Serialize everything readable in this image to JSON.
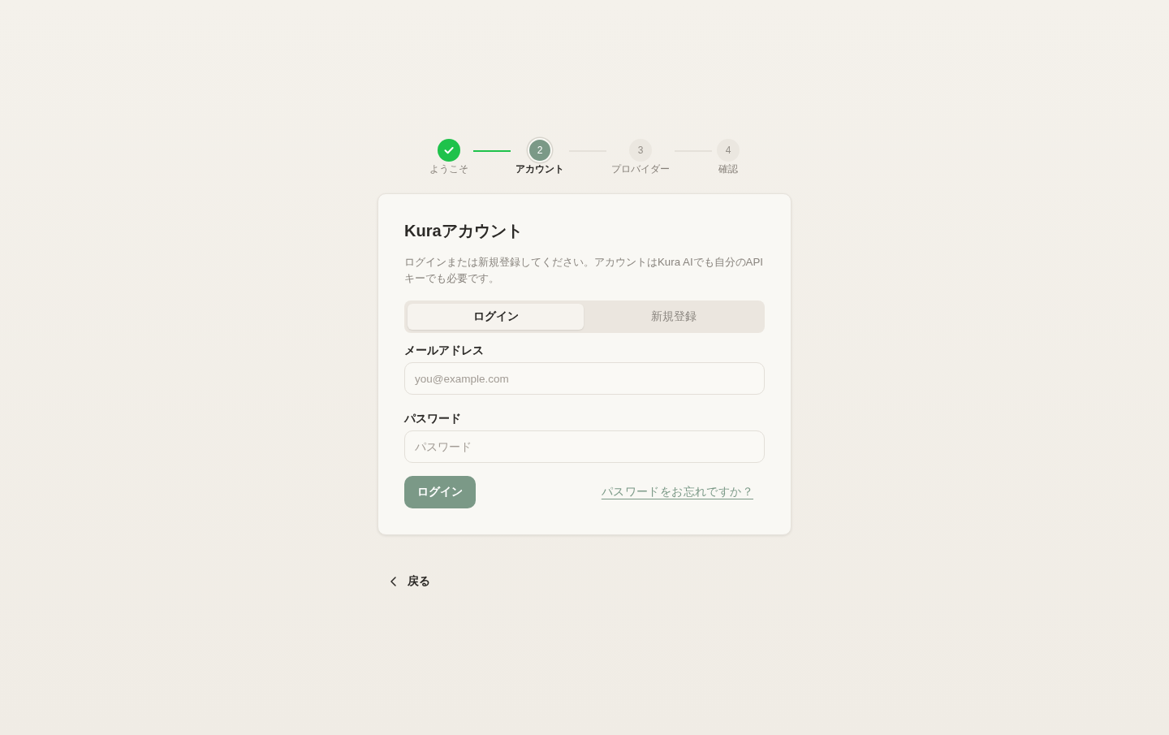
{
  "stepper": {
    "steps": [
      {
        "label": "ようこそ",
        "completed": true,
        "current": false
      },
      {
        "number": "2",
        "label": "アカウント",
        "completed": false,
        "current": true
      },
      {
        "number": "3",
        "label": "プロバイダー",
        "completed": false,
        "current": false
      },
      {
        "number": "4",
        "label": "確認",
        "completed": false,
        "current": false
      }
    ]
  },
  "card": {
    "title": "Kuraアカウント",
    "description": "ログインまたは新規登録してください。アカウントはKura AIでも自分のAPIキーでも必要です。",
    "tabs": [
      {
        "label": "ログイン",
        "selected": true
      },
      {
        "label": "新規登録",
        "selected": false
      }
    ],
    "fields": [
      {
        "label": "メールアドレス",
        "placeholder": "you@example.com"
      },
      {
        "label": "パスワード",
        "placeholder": "パスワード"
      }
    ],
    "submit_button": "ログイン",
    "forgot_link": "パスワードをお忘れですか？"
  },
  "back_button": {
    "label": "戻る"
  }
}
